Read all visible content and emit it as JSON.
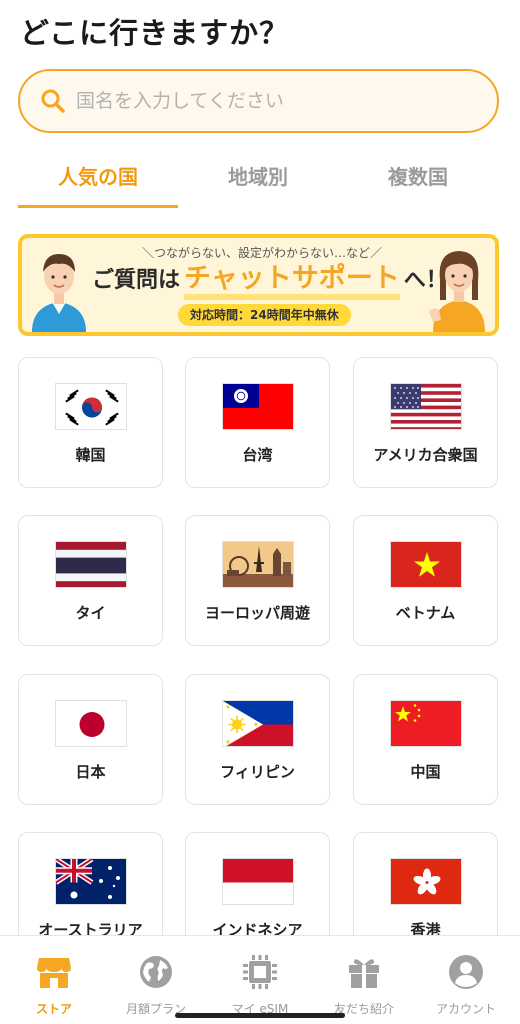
{
  "header": {
    "title": "どこに行きますか？"
  },
  "search": {
    "placeholder": "国名を入力してください"
  },
  "tabs": [
    {
      "label": "人気の国",
      "active": true
    },
    {
      "label": "地域別",
      "active": false
    },
    {
      "label": "複数国",
      "active": false
    }
  ],
  "banner": {
    "top_text": "＼つながらない、設定がわからない…など／",
    "main_prefix": "ご質問は",
    "main_highlight": "チャットサポート",
    "main_suffix": "へ！",
    "hours": "対応時間：24時間年中無休"
  },
  "countries": [
    {
      "label": "韓国",
      "flag": "korea-flag"
    },
    {
      "label": "台湾",
      "flag": "taiwan-flag"
    },
    {
      "label": "アメリカ合衆国",
      "flag": "usa-flag"
    },
    {
      "label": "タイ",
      "flag": "thailand-flag"
    },
    {
      "label": "ヨーロッパ周遊",
      "flag": "europe-tour-icon"
    },
    {
      "label": "ベトナム",
      "flag": "vietnam-flag"
    },
    {
      "label": "日本",
      "flag": "japan-flag"
    },
    {
      "label": "フィリピン",
      "flag": "philippines-flag"
    },
    {
      "label": "中国",
      "flag": "china-flag"
    },
    {
      "label": "オーストラリア",
      "flag": "australia-flag"
    },
    {
      "label": "インドネシア",
      "flag": "indonesia-flag"
    },
    {
      "label": "香港",
      "flag": "hongkong-flag"
    }
  ],
  "bottom_nav": [
    {
      "label": "ストア",
      "icon": "store-icon",
      "active": true
    },
    {
      "label": "月額プラン",
      "icon": "globe-icon",
      "active": false
    },
    {
      "label": "マイ eSIM",
      "icon": "sim-chip-icon",
      "active": false
    },
    {
      "label": "友だち紹介",
      "icon": "gift-icon",
      "active": false
    },
    {
      "label": "アカウント",
      "icon": "account-icon",
      "active": false
    }
  ],
  "colors": {
    "accent": "#f5a623",
    "accent_text": "#f29a10",
    "banner_border": "#fdc72f",
    "inactive": "#9a9a9a"
  }
}
